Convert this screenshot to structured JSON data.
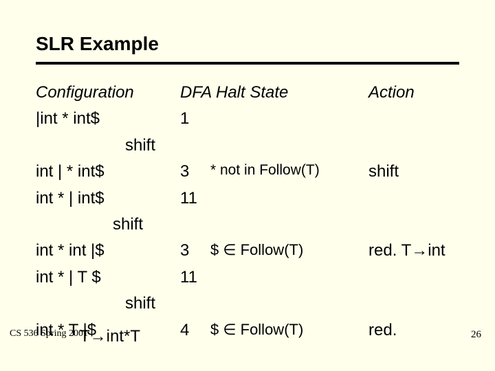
{
  "title": "SLR Example",
  "header": {
    "conf": "Configuration",
    "state_full": "DFA Halt State",
    "action": "Action"
  },
  "rows": [
    {
      "conf": "|int * int$",
      "state": "1",
      "note": "",
      "action": ""
    },
    {
      "shift_indent": "shift"
    },
    {
      "conf": "int | * int$",
      "state": "3",
      "note": "* not in Follow(T)",
      "action": "shift"
    },
    {
      "conf": "int * | int$",
      "state": "11",
      "note": "",
      "action": ""
    },
    {
      "shift_small": "shift"
    },
    {
      "conf": "int * int |$",
      "state": "3",
      "note": "$ ∈ Follow(T)",
      "action": "red. T→int"
    },
    {
      "conf": "int * | T $",
      "state": "11",
      "note": "",
      "action": ""
    },
    {
      "shift_indent": "shift"
    },
    {
      "conf": "int * T |$",
      "state": "4",
      "note": "$ ∈ Follow(T)",
      "action": "red."
    }
  ],
  "last_production": "T→int*T",
  "footer_left": "CS 536  Spring 2001",
  "footer_right": "26"
}
